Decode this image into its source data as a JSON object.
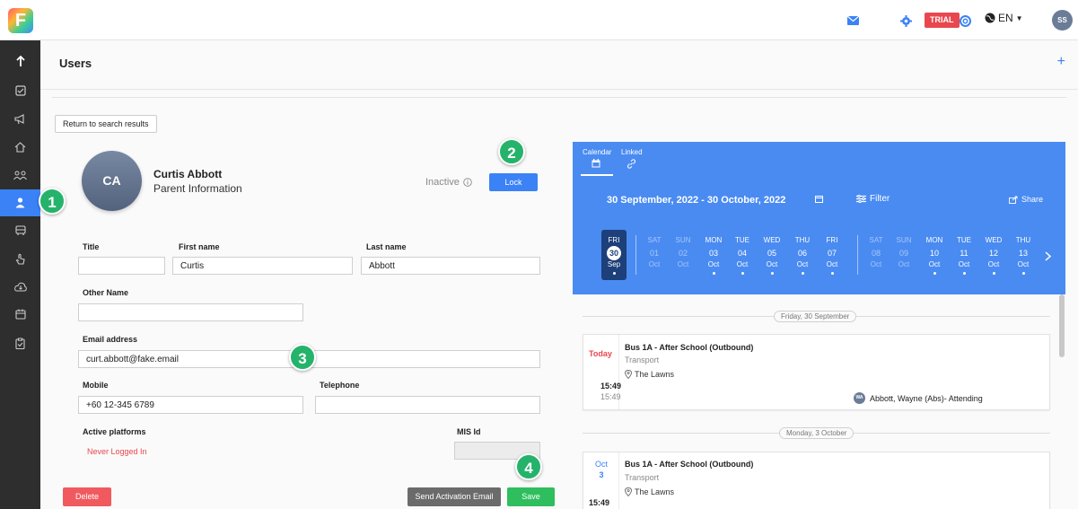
{
  "app": {
    "logo_letter": "F"
  },
  "topbar": {
    "trial_label": "TRIAL",
    "language": "EN",
    "user_initials": "SS",
    "accent": "#3b82f6"
  },
  "page": {
    "title": "Users",
    "add": "+"
  },
  "profile": {
    "return_label": "Return to search results",
    "initials": "CA",
    "name": "Curtis Abbott",
    "role": "Parent Information",
    "status": "Inactive",
    "lock_label": "Lock"
  },
  "form": {
    "title_label": "Title",
    "title_value": "",
    "first_name_label": "First name",
    "first_name_value": "Curtis",
    "last_name_label": "Last name",
    "last_name_value": "Abbott",
    "other_name_label": "Other Name",
    "other_name_value": "",
    "email_label": "Email address",
    "email_value": "curt.abbott@fake.email",
    "mobile_label": "Mobile",
    "mobile_value": "+60 12-345 6789",
    "telephone_label": "Telephone",
    "telephone_value": "",
    "platforms_label": "Active platforms",
    "platforms_value": "Never Logged In",
    "mis_label": "MIS Id",
    "mis_value": ""
  },
  "actions": {
    "delete_label": "Delete",
    "activation_label": "Send Activation Email",
    "save_label": "Save"
  },
  "markers": [
    "1",
    "2",
    "3",
    "4"
  ],
  "calendar": {
    "tab_calendar": "Calendar",
    "tab_linked": "Linked",
    "range": "30 September, 2022 - 30 October, 2022",
    "filter_label": "Filter",
    "share_label": "Share",
    "days": [
      {
        "dow": "FRI",
        "num": "30",
        "mon": "Sep",
        "dot": true,
        "dim": false,
        "selected": true
      },
      {
        "dow": "SAT",
        "num": "01",
        "mon": "Oct",
        "dot": false,
        "dim": true,
        "selected": false
      },
      {
        "dow": "SUN",
        "num": "02",
        "mon": "Oct",
        "dot": false,
        "dim": true,
        "selected": false
      },
      {
        "dow": "MON",
        "num": "03",
        "mon": "Oct",
        "dot": true,
        "dim": false,
        "selected": false
      },
      {
        "dow": "TUE",
        "num": "04",
        "mon": "Oct",
        "dot": true,
        "dim": false,
        "selected": false
      },
      {
        "dow": "WED",
        "num": "05",
        "mon": "Oct",
        "dot": true,
        "dim": false,
        "selected": false
      },
      {
        "dow": "THU",
        "num": "06",
        "mon": "Oct",
        "dot": true,
        "dim": false,
        "selected": false
      },
      {
        "dow": "FRI",
        "num": "07",
        "mon": "Oct",
        "dot": true,
        "dim": false,
        "selected": false
      },
      {
        "dow": "SAT",
        "num": "08",
        "mon": "Oct",
        "dot": false,
        "dim": true,
        "selected": false
      },
      {
        "dow": "SUN",
        "num": "09",
        "mon": "Oct",
        "dot": false,
        "dim": true,
        "selected": false
      },
      {
        "dow": "MON",
        "num": "10",
        "mon": "Oct",
        "dot": true,
        "dim": false,
        "selected": false
      },
      {
        "dow": "TUE",
        "num": "11",
        "mon": "Oct",
        "dot": true,
        "dim": false,
        "selected": false
      },
      {
        "dow": "WED",
        "num": "12",
        "mon": "Oct",
        "dot": true,
        "dim": false,
        "selected": false
      },
      {
        "dow": "THU",
        "num": "13",
        "mon": "Oct",
        "dot": true,
        "dim": false,
        "selected": false
      }
    ]
  },
  "events": {
    "date1": "Friday, 30 September",
    "date2": "Monday, 3 October",
    "e1": {
      "badge": "Today",
      "time_start": "15:49",
      "time_end": "15:49",
      "title": "Bus 1A - After School (Outbound)",
      "category": "Transport",
      "location": "The Lawns",
      "attendee_initials": "WA",
      "attendee": "Abbott, Wayne (Abs)- Attending"
    },
    "e2": {
      "month": "Oct",
      "day": "3",
      "time_start": "15:49",
      "title": "Bus 1A - After School (Outbound)",
      "category": "Transport",
      "location": "The Lawns"
    }
  }
}
